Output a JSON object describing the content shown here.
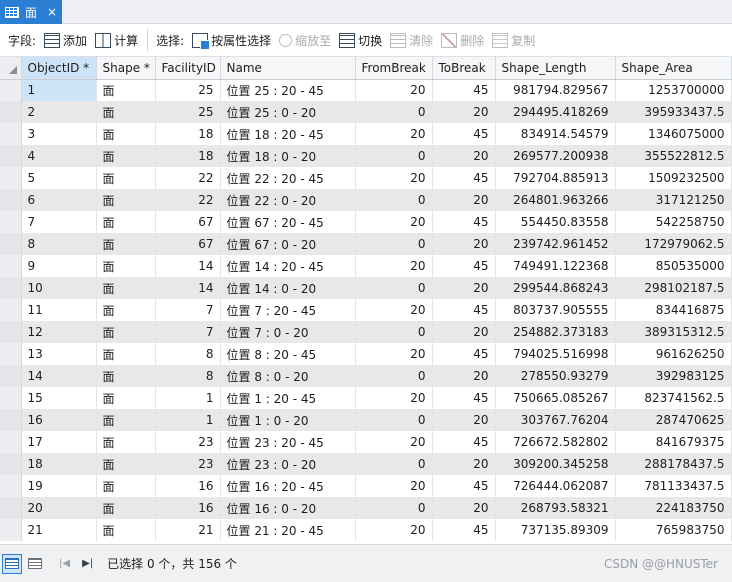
{
  "tab": {
    "title": "面",
    "close": "×"
  },
  "toolbar": {
    "fields_label": "字段:",
    "add_label": "添加",
    "calculate_label": "计算",
    "selection_label": "选择:",
    "select_by_attr_label": "按属性选择",
    "zoom_to_label": "缩放至",
    "switch_label": "切换",
    "clear_label": "清除",
    "delete_label": "删除",
    "copy_label": "复制"
  },
  "table": {
    "columns": [
      "ObjectID *",
      "Shape *",
      "FacilityID",
      "Name",
      "FromBreak",
      "ToBreak",
      "Shape_Length",
      "Shape_Area"
    ],
    "rows": [
      [
        "1",
        "面",
        "25",
        "位置 25 : 20 - 45",
        "20",
        "45",
        "981794.829567",
        "1253700000"
      ],
      [
        "2",
        "面",
        "25",
        "位置 25 : 0 - 20",
        "0",
        "20",
        "294495.418269",
        "395933437.5"
      ],
      [
        "3",
        "面",
        "18",
        "位置 18 : 20 - 45",
        "20",
        "45",
        "834914.54579",
        "1346075000"
      ],
      [
        "4",
        "面",
        "18",
        "位置 18 : 0 - 20",
        "0",
        "20",
        "269577.200938",
        "355522812.5"
      ],
      [
        "5",
        "面",
        "22",
        "位置 22 : 20 - 45",
        "20",
        "45",
        "792704.885913",
        "1509232500"
      ],
      [
        "6",
        "面",
        "22",
        "位置 22 : 0 - 20",
        "0",
        "20",
        "264801.963266",
        "317121250"
      ],
      [
        "7",
        "面",
        "67",
        "位置 67 : 20 - 45",
        "20",
        "45",
        "554450.83558",
        "542258750"
      ],
      [
        "8",
        "面",
        "67",
        "位置 67 : 0 - 20",
        "0",
        "20",
        "239742.961452",
        "172979062.5"
      ],
      [
        "9",
        "面",
        "14",
        "位置 14 : 20 - 45",
        "20",
        "45",
        "749491.122368",
        "850535000"
      ],
      [
        "10",
        "面",
        "14",
        "位置 14 : 0 - 20",
        "0",
        "20",
        "299544.868243",
        "298102187.5"
      ],
      [
        "11",
        "面",
        "7",
        "位置 7 : 20 - 45",
        "20",
        "45",
        "803737.905555",
        "834416875"
      ],
      [
        "12",
        "面",
        "7",
        "位置 7 : 0 - 20",
        "0",
        "20",
        "254882.373183",
        "389315312.5"
      ],
      [
        "13",
        "面",
        "8",
        "位置 8 : 20 - 45",
        "20",
        "45",
        "794025.516998",
        "961626250"
      ],
      [
        "14",
        "面",
        "8",
        "位置 8 : 0 - 20",
        "0",
        "20",
        "278550.93279",
        "392983125"
      ],
      [
        "15",
        "面",
        "1",
        "位置 1 : 20 - 45",
        "20",
        "45",
        "750665.085267",
        "823741562.5"
      ],
      [
        "16",
        "面",
        "1",
        "位置 1 : 0 - 20",
        "0",
        "20",
        "303767.76204",
        "287470625"
      ],
      [
        "17",
        "面",
        "23",
        "位置 23 : 20 - 45",
        "20",
        "45",
        "726672.582802",
        "841679375"
      ],
      [
        "18",
        "面",
        "23",
        "位置 23 : 0 - 20",
        "0",
        "20",
        "309200.345258",
        "288178437.5"
      ],
      [
        "19",
        "面",
        "16",
        "位置 16 : 20 - 45",
        "20",
        "45",
        "726444.062087",
        "781133437.5"
      ],
      [
        "20",
        "面",
        "16",
        "位置 16 : 0 - 20",
        "0",
        "20",
        "268793.58321",
        "224183750"
      ],
      [
        "21",
        "面",
        "21",
        "位置 21 : 20 - 45",
        "20",
        "45",
        "737135.89309",
        "765983750"
      ]
    ]
  },
  "status": {
    "text": "已选择 0 个，共 156 个",
    "watermark": "CSDN @@HNUSTer"
  }
}
